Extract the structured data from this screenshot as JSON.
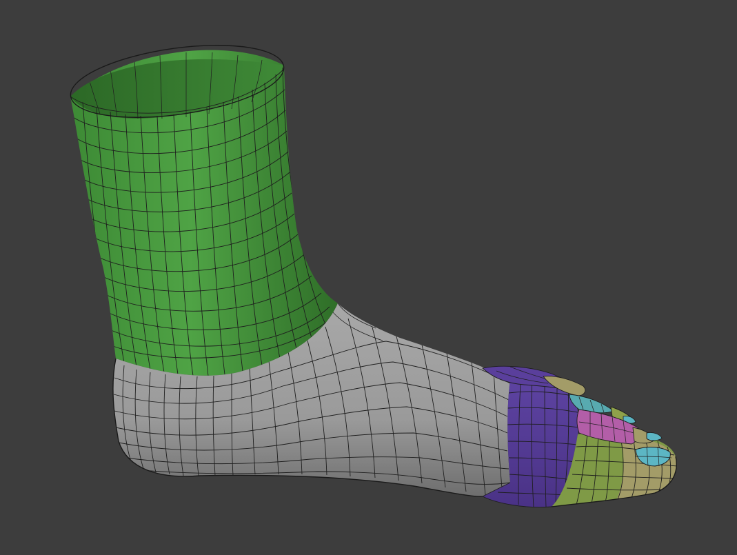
{
  "viewport": {
    "background": "#3d3d3d"
  },
  "model": {
    "subject": "foot-mesh",
    "polygroups": [
      {
        "name": "leg",
        "color": "#4a9a40"
      },
      {
        "name": "foot-body",
        "color": "#9c9c9c"
      },
      {
        "name": "toe-ring",
        "color": "#5b3f9c"
      },
      {
        "name": "toes-green",
        "color": "#7f9a46"
      },
      {
        "name": "toes-tan",
        "color": "#a19a68"
      },
      {
        "name": "toe-pink",
        "color": "#b35ea8"
      },
      {
        "name": "nail-cyan",
        "color": "#5cb6c4"
      },
      {
        "name": "wireframe",
        "color": "#1e1e1e"
      }
    ]
  }
}
